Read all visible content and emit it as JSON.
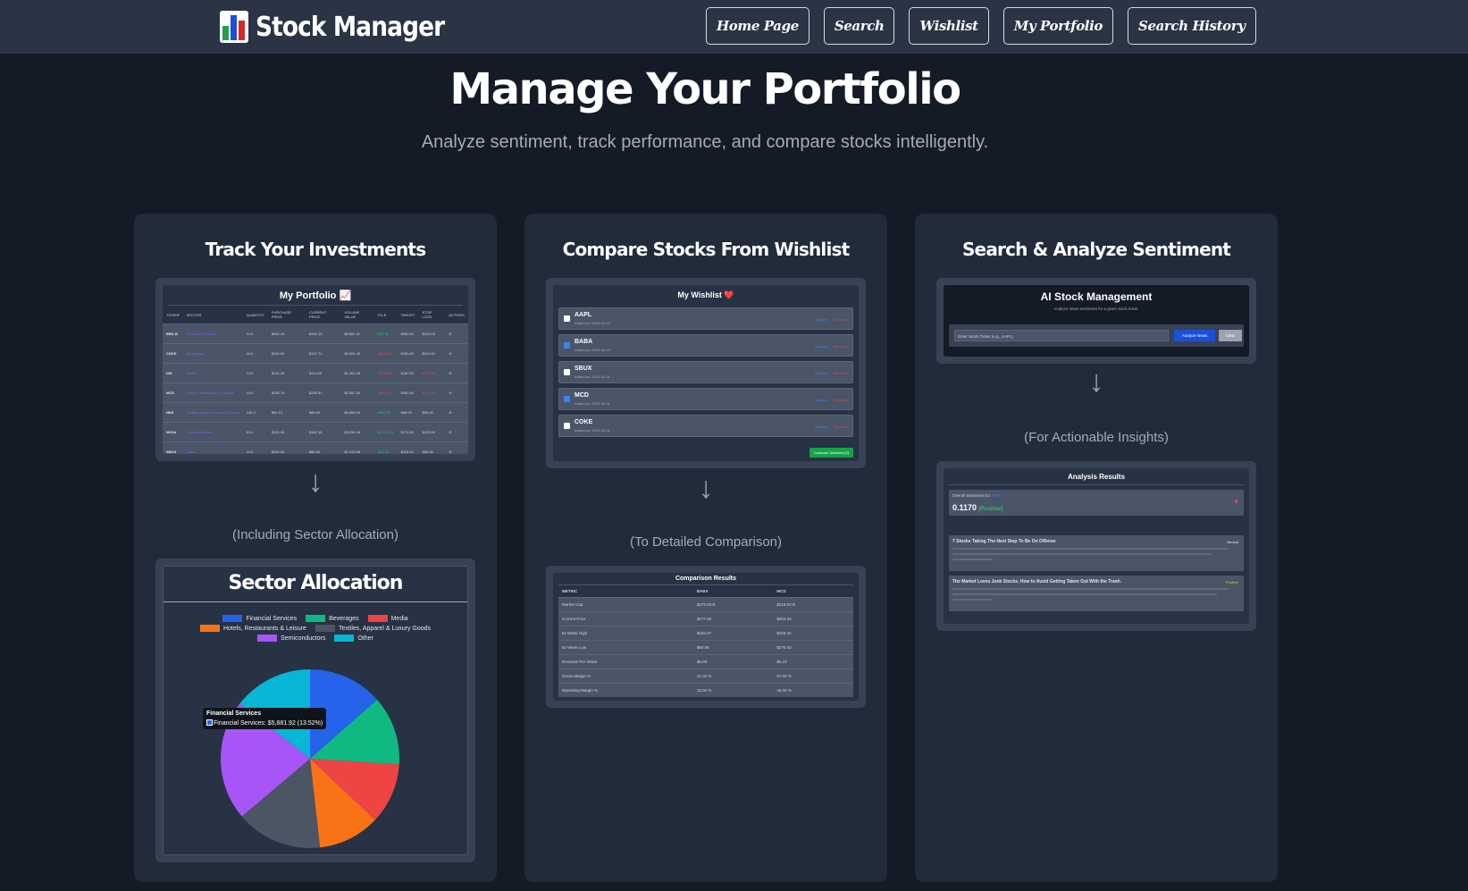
{
  "brand": {
    "logo": "bar-chart-emoji",
    "name": "Stock Manager"
  },
  "nav": [
    "Home Page",
    "Search",
    "Wishlist",
    "My Portfolio",
    "Search History"
  ],
  "hero": {
    "title": "Manage Your Portfolio",
    "subtitle": "Analyze sentiment, track performance, and compare stocks intelligently."
  },
  "colors": {
    "accent_blue": "#2563eb",
    "positive": "#22c55e",
    "negative": "#ef4444",
    "panel": "#212b3a",
    "background": "#141a26"
  },
  "columns": [
    {
      "title": "Track Your Investments",
      "caption": "(Including Sector Allocation)"
    },
    {
      "title": "Compare Stocks From Wishlist",
      "caption": "(To Detailed Comparison)"
    },
    {
      "title": "Search & Analyze Sentiment",
      "caption": "(For Actionable Insights)"
    }
  ],
  "portfolio": {
    "title": "My Portfolio 📈",
    "headers": [
      "TICKER",
      "SECTOR",
      "QUANTITY",
      "PURCHASE PRICE",
      "CURRENT PRICE",
      "VOLUME VALUE",
      "P/L $",
      "TARGET",
      "STOP LOSS",
      "ACTIONS"
    ],
    "rows": [
      {
        "ticker": "BRK-B",
        "sector": "Financial Services",
        "qty": "12.0",
        "purchase": "$490.10",
        "current": "$490.15",
        "value": "$5,881.92",
        "pl": "$30.82",
        "pl_sign": "pos",
        "target": "$550.00",
        "stop": "$420.00",
        "stop_sign": "",
        "action": "⊘"
      },
      {
        "ticker": "COKE",
        "sector": "Beverages",
        "qty": "44.0",
        "purchase": "$130.00",
        "current": "$127.71",
        "value": "$5,591.40",
        "pl": "-$100.60",
        "pl_sign": "neg",
        "target": "$150.00",
        "stop": "$115.00",
        "stop_sign": "",
        "action": "⊘"
      },
      {
        "ticker": "DIS",
        "sector": "Media",
        "qty": "13.0",
        "purchase": "$130.00",
        "current": "$111.65",
        "value": "$1,451.45",
        "pl": "-$238.55",
        "pl_sign": "neg",
        "target": "$150.00",
        "stop": "$120.00",
        "stop_sign": "neg",
        "action": "⊘"
      },
      {
        "ticker": "MCD",
        "sector": "Hotels, Restaurants & Leisure",
        "qty": "10.0",
        "purchase": "$335.70",
        "current": "$295.81",
        "value": "$2,957.40",
        "pl": "-$403.10",
        "pl_sign": "neg",
        "target": "$400.00",
        "stop": "$310.00",
        "stop_sign": "neg",
        "action": "⊘"
      },
      {
        "ticker": "NKE",
        "sector": "Textiles, Apparel & Luxury Goods",
        "qty": "100.0",
        "purchase": "$60.13",
        "current": "$68.66",
        "value": "$6,866.00",
        "pl": "$853.00",
        "pl_sign": "pos",
        "target": "$85.00",
        "stop": "$55.00",
        "stop_sign": "",
        "action": "⊘"
      },
      {
        "ticker": "NVDA",
        "sector": "Semiconductors",
        "qty": "51.0",
        "purchase": "$120.00",
        "current": "$182.16",
        "value": "$9,290.16",
        "pl": "$3,170.16",
        "pl_sign": "pos",
        "target": "$170.00",
        "stop": "$125.00",
        "stop_sign": "",
        "action": "⊘"
      },
      {
        "ticker": "SBUX",
        "sector": "Other",
        "qty": "12.0",
        "purchase": "$100.00",
        "current": "$86.09",
        "value": "$1,033.08",
        "pl": "$33.08",
        "pl_sign": "pos",
        "target": "$110.00",
        "stop": "$80.00",
        "stop_sign": "",
        "action": "⊘"
      }
    ]
  },
  "sector_chart": {
    "title": "Sector Allocation",
    "tooltip_title": "Financial Services",
    "tooltip_text": "Financial Services: $5,881.92 (13.52%)"
  },
  "chart_data": {
    "type": "pie",
    "categories": [
      "Financial Services",
      "Beverages",
      "Media",
      "Hotels, Restaurants & Leisure",
      "Textiles, Apparel & Luxury Goods",
      "Semiconductors",
      "Other"
    ],
    "values": [
      13.52,
      12.5,
      11.0,
      11.2,
      15.6,
      21.8,
      14.38
    ],
    "colors": [
      "#2563eb",
      "#10b981",
      "#ef4444",
      "#f97316",
      "#4b5563",
      "#a855f7",
      "#06b6d4"
    ],
    "legend_position": "top"
  },
  "wishlist": {
    "title": "My Wishlist ❤️",
    "items": [
      {
        "ticker": "AAPL",
        "added": "Added on: 2025-10-24",
        "checked": false
      },
      {
        "ticker": "BABA",
        "added": "Added on: 2025-10-22",
        "checked": true
      },
      {
        "ticker": "SBUX",
        "added": "Added on: 2025-10-31",
        "checked": false
      },
      {
        "ticker": "MCD",
        "added": "Added on: 2025-10-31",
        "checked": true
      },
      {
        "ticker": "COKE",
        "added": "Added on: 2025-10-31",
        "checked": false
      }
    ],
    "analyze_label": "Analyze",
    "remove_label": "Remove",
    "compare_label": "Compare Selected (2)"
  },
  "comparison": {
    "title": "Comparison Results",
    "headers": [
      "METRIC",
      "BABA",
      "MCD"
    ],
    "rows": [
      [
        "Market Cap",
        "$379.03 B",
        "$218.03 B"
      ],
      [
        "Current Price",
        "$177.93",
        "$304.63"
      ],
      [
        "52 Week High",
        "$192.67",
        "$326.32"
      ],
      [
        "52 Week Low",
        "$80.06",
        "$276.53"
      ],
      [
        "Revenue Per Share",
        "$5.09",
        "$5.23"
      ],
      [
        "Gross Margin %",
        "41.00 %",
        "57.00 %"
      ],
      [
        "Operating Margin %",
        "13.00 %",
        "46.00 %"
      ]
    ],
    "signs": [
      [
        "",
        ""
      ],
      [
        "",
        ""
      ],
      [
        "",
        ""
      ],
      [
        "",
        ""
      ],
      [
        "pos",
        "neg"
      ],
      [
        "neg",
        "pos"
      ],
      [
        "neg",
        "pos"
      ]
    ]
  },
  "ai": {
    "title": "AI Stock Management",
    "subtitle": "Analyze news sentiment for a given stock ticker.",
    "placeholder": "Enter Stock Ticker (e.g., AAPL)",
    "analyze_label": "Analyze News",
    "clear_label": "Clear"
  },
  "analysis": {
    "title": "Analysis Results",
    "sentiment_label": "Overall Sentiment for",
    "ticker": "AAPL",
    "score": "0.1170",
    "sentiment": "(Positive)",
    "news": [
      {
        "title": "7 Stocks Taking The Next Step To Be On Offense",
        "sentiment": "Neutral"
      },
      {
        "title": "The Market Loves Junk Stocks. How to Avoid Getting Taken Out With the Trash.",
        "sentiment": "Positive"
      }
    ]
  }
}
